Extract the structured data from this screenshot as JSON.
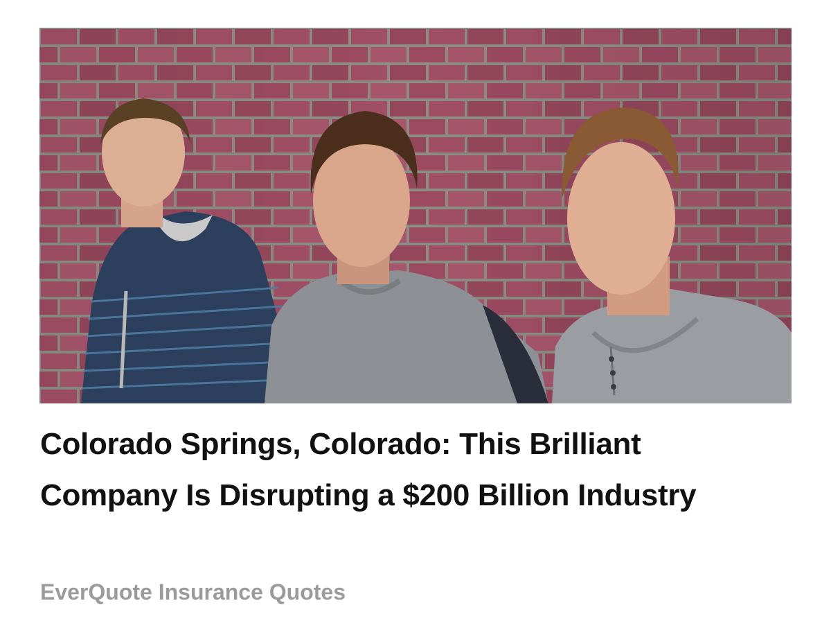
{
  "ad": {
    "image": {
      "alt": "Three young men standing in front of a red brick wall"
    },
    "headline": "Colorado Springs, Colorado: This Brilliant Company Is Disrupting a $200 Billion Industry",
    "sponsor": "EverQuote Insurance Quotes"
  },
  "colors": {
    "brick": "#9a4e60",
    "mortar": "#8c8c86",
    "headline_text": "#111111",
    "sponsor_text": "#9b9b9b",
    "background": "#ffffff"
  }
}
